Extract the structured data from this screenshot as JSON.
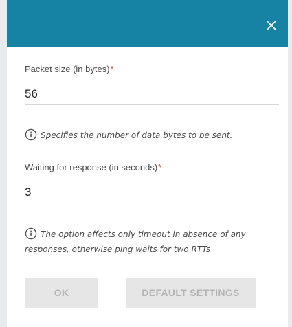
{
  "dialog": {
    "close_icon": "close-icon",
    "header_color": "#1683a4"
  },
  "packet_size": {
    "label": "Packet size (in bytes)",
    "required_mark": "*",
    "value": "56",
    "hint": "Specifies the number of data bytes to be sent."
  },
  "waiting": {
    "label": "Waiting for response (in seconds)",
    "required_mark": "*",
    "value": "3",
    "hint": "The option affects only timeout in absence of any responses, otherwise ping waits for two RTTs"
  },
  "buttons": {
    "ok_label": "OK",
    "default_label": "DEFAULT SETTINGS"
  },
  "colors": {
    "accent": "#1683a4",
    "required": "#e4471c",
    "button_disabled_bg": "#e6e6e6",
    "button_disabled_text": "#b4b4b4"
  }
}
